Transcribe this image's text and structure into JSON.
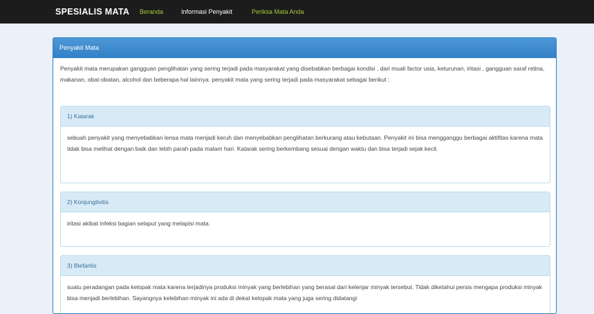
{
  "navbar": {
    "brand": "SPESIALIS MATA",
    "links": [
      {
        "label": "Beranda"
      },
      {
        "label": "Informasi Penyakit"
      },
      {
        "label": "Periksa Mata Anda"
      }
    ]
  },
  "panel": {
    "title": "Penyakit Mata",
    "intro": "Penyakit mata merupakan gangguan penglihatan yang sering terjadi pada masyarakat yang disebabkan berbagai kondisi , dari muali factor usia, keturunan, iritasi , gangguan saraf retina, makanan, obat-obatan, alcohol dan beberapa hal lainnya. penyakit mata yang sering terjadi pada masyarakat sebagai berikut :",
    "diseases": [
      {
        "title": "1) Katarak",
        "description": "sebuah penyakit yang menyebabkan lensa mata menjadi keruh dan menyebabkan penglihatan berkurang atau kebutaan. Penyakit ini bisa mengganggu berbagai aktifitas karena mata tidak bisa melihat dengan baik dan lebih parah pada malam hari. Katarak sering berkembang sesuai dengan waktu dan bisa terjadi sejak kecil."
      },
      {
        "title": "2) Konjungtivitis",
        "description": "iritasi akibat infeksi bagian selaput yang melapisi mata."
      },
      {
        "title": "3) Blefaritis",
        "description": "suatu peradangan pada kelopak mata karena terjadinya produksi minyak yang berlebihan yang berasal dari kelenjar minyak tersebut. Tidak diketahui persis mengapa produksi minyak bisa menjadi berlebihan. Sayangnya kelebihan minyak ini ada di dekat kelopak mata yang juga sering didatangi"
      }
    ]
  },
  "colors": {
    "navbar_bg": "#1c1c1c",
    "nav_green": "#a8c93a",
    "panel_primary": "#3280c6",
    "sub_heading_bg": "#d7eaf6",
    "page_bg": "#eaf1f8"
  }
}
